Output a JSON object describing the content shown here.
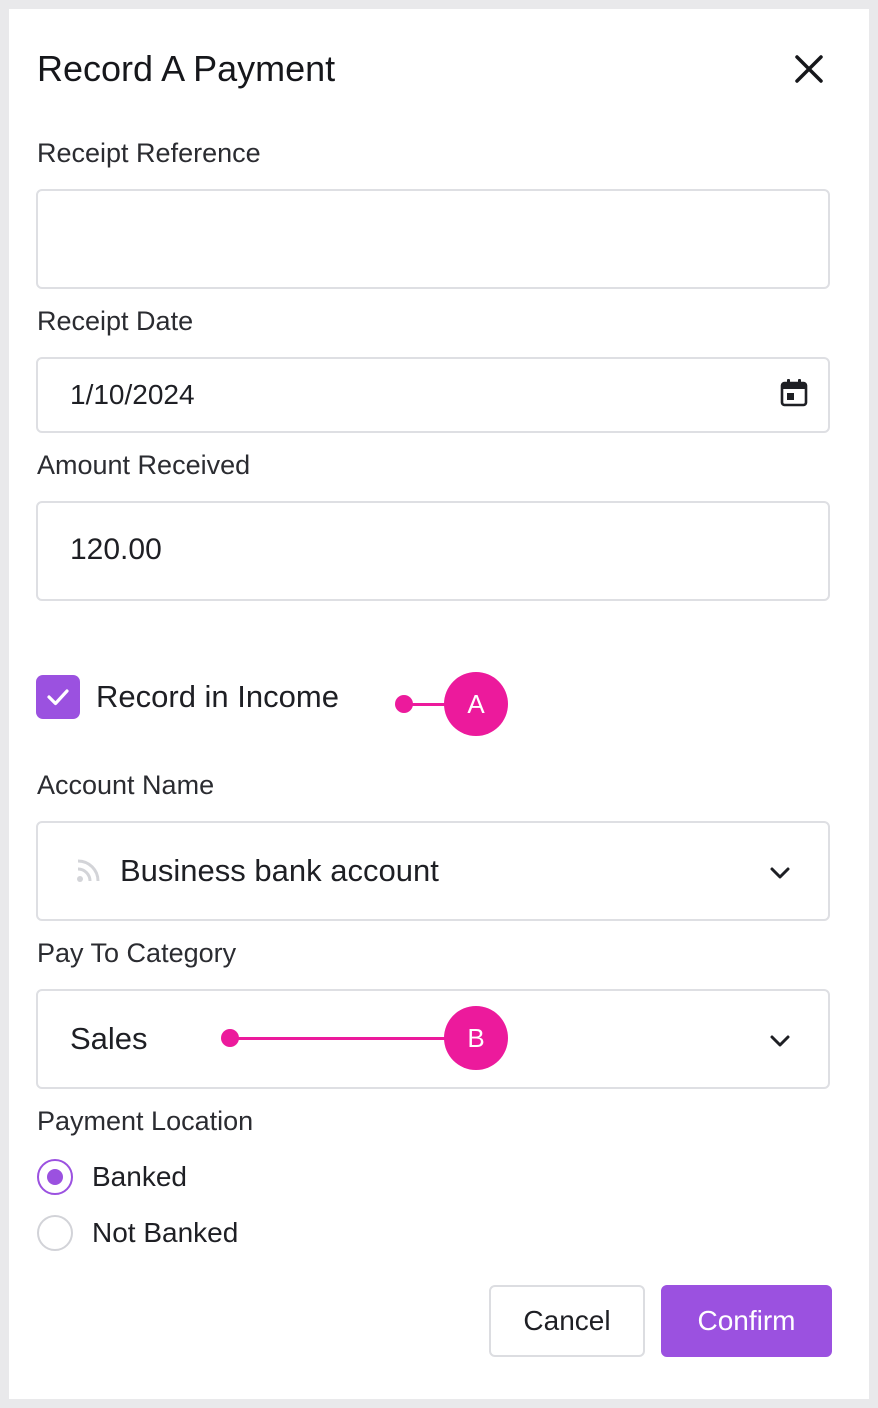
{
  "dialog": {
    "title": "Record A Payment",
    "close_icon": "close-icon"
  },
  "receipt_reference": {
    "label": "Receipt Reference",
    "value": ""
  },
  "receipt_date": {
    "label": "Receipt Date",
    "value": "1/10/2024",
    "icon": "calendar-icon"
  },
  "amount_received": {
    "label": "Amount Received",
    "value": "120.00"
  },
  "record_in_income": {
    "label": "Record in Income",
    "checked": true
  },
  "account_name": {
    "label": "Account Name",
    "value": "Business bank account",
    "icon": "rss-feed-icon"
  },
  "pay_to_category": {
    "label": "Pay To Category",
    "value": "Sales"
  },
  "payment_location": {
    "label": "Payment Location",
    "options": [
      {
        "label": "Banked",
        "selected": true
      },
      {
        "label": "Not Banked",
        "selected": false
      }
    ]
  },
  "actions": {
    "cancel_label": "Cancel",
    "confirm_label": "Confirm"
  },
  "callouts": {
    "a": "A",
    "b": "B"
  },
  "colors": {
    "accent": "#9b51e0",
    "callout": "#ec1a9c",
    "border": "#dedfe3"
  }
}
